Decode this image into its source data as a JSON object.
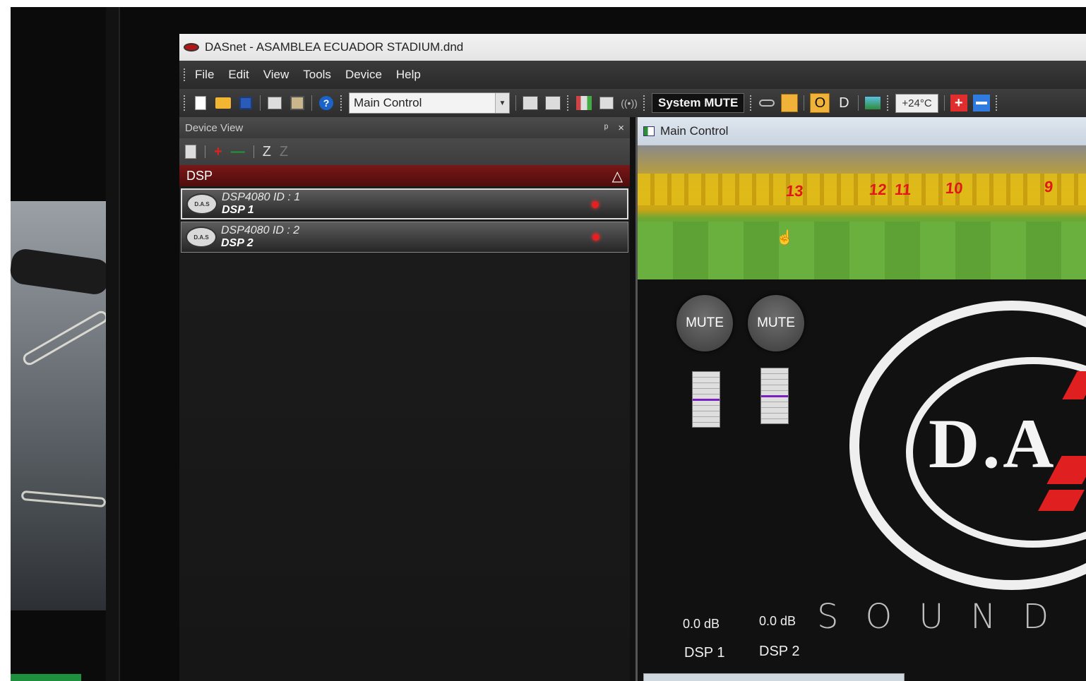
{
  "window": {
    "title": "DASnet - ASAMBLEA ECUADOR STADIUM.dnd"
  },
  "menu": {
    "items": [
      "File",
      "Edit",
      "View",
      "Tools",
      "Device",
      "Help"
    ]
  },
  "toolbar": {
    "view_select_value": "Main Control",
    "system_mute_label": "System MUTE",
    "o_label": "O",
    "d_label": "D",
    "temperature": "+24°C",
    "plus_label": "+"
  },
  "device_view": {
    "title": "Device View",
    "pin_label": "ᵖ",
    "close_label": "×",
    "tools": {
      "add": "+",
      "remove": "—",
      "z_label": "Z",
      "z_dim_label": "Z"
    },
    "category": "DSP",
    "category_toggle": "△",
    "devices": [
      {
        "model": "DSP4080  ID : 1",
        "name": "DSP 1",
        "logo": "D.A.S"
      },
      {
        "model": "DSP4080  ID : 2",
        "name": "DSP 2",
        "logo": "D.A.S"
      }
    ]
  },
  "main_control": {
    "tab_label": "Main Control",
    "zones": [
      "13",
      "12",
      "11",
      "10",
      "9"
    ],
    "channels": [
      {
        "mute_label": "MUTE",
        "level": "0.0 dB",
        "name": "DSP 1",
        "fader_position": 0.5
      },
      {
        "mute_label": "MUTE",
        "level": "0.0 dB",
        "name": "DSP 2",
        "fader_position": 0.5
      }
    ],
    "logo_text": "D.A",
    "tagline": "SOUND W"
  },
  "colors": {
    "accent_red": "#e02020",
    "category_bg": "#6a1414",
    "fader_line": "#7a1fc0",
    "highlight_orange": "#f0b238"
  },
  "icons": [
    "app-icon",
    "new-icon",
    "open-icon",
    "save-icon",
    "copy-icon",
    "paste-icon",
    "help-icon",
    "grid-icon",
    "network-icon",
    "radio-icon",
    "link-icon",
    "lock-icon",
    "image-icon",
    "plus-icon",
    "minus-icon",
    "hand-cursor-icon"
  ]
}
